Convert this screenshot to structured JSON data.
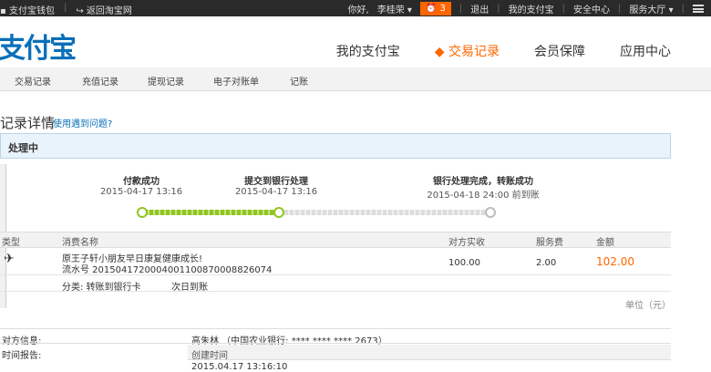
{
  "topbar": {
    "wallet": "支付宝钱包",
    "back": "返回淘宝网",
    "greeting": "你好,",
    "user": "李桂荣 ▾",
    "bell_count": "3",
    "logout": "退出",
    "my_alipay": "我的支付宝",
    "security": "安全中心",
    "service": "服务大厅 ▾"
  },
  "logo": "支付宝",
  "nav": [
    "我的支付宝",
    "◆ 交易记录",
    "会员保障",
    "应用中心"
  ],
  "subnav": [
    "交易记录",
    "充值记录",
    "提现记录",
    "电子对账单",
    "记账"
  ],
  "page_title": "记录详情",
  "help_link": "使用遇到问题?",
  "status": "处理中",
  "steps": [
    {
      "label": "付款成功",
      "time": "2015-04-17 13:16"
    },
    {
      "label": "提交到银行处理",
      "time": "2015-04-17 13:16"
    },
    {
      "label": "银行处理完成，转账成功",
      "time": "2015-04-18 24:00 前到账"
    }
  ],
  "colors": {
    "green": "#8fc61f",
    "orange": "#ff6600",
    "grey": "#cccccc"
  },
  "table": {
    "headers": [
      "类型",
      "消费名称",
      "对方实收",
      "服务费",
      "金额"
    ],
    "item_name": "原王子轩小朋友早日康复健康成长!",
    "serial": "流水号 2015041720004001100870008826074",
    "received": "100.00",
    "fee": "2.00",
    "amount": "102.00",
    "category": "分类: 转账到银行卡",
    "arrival": "次日到账"
  },
  "unit": "单位（元）",
  "info": {
    "counterparty_label": "对方信息:",
    "counterparty_value": "高朱林 （中国农业银行: **** **** **** 2673）",
    "time_label": "时间报告:",
    "time_header": "创建时间",
    "time_value": "2015.04.17 13:16:10"
  }
}
